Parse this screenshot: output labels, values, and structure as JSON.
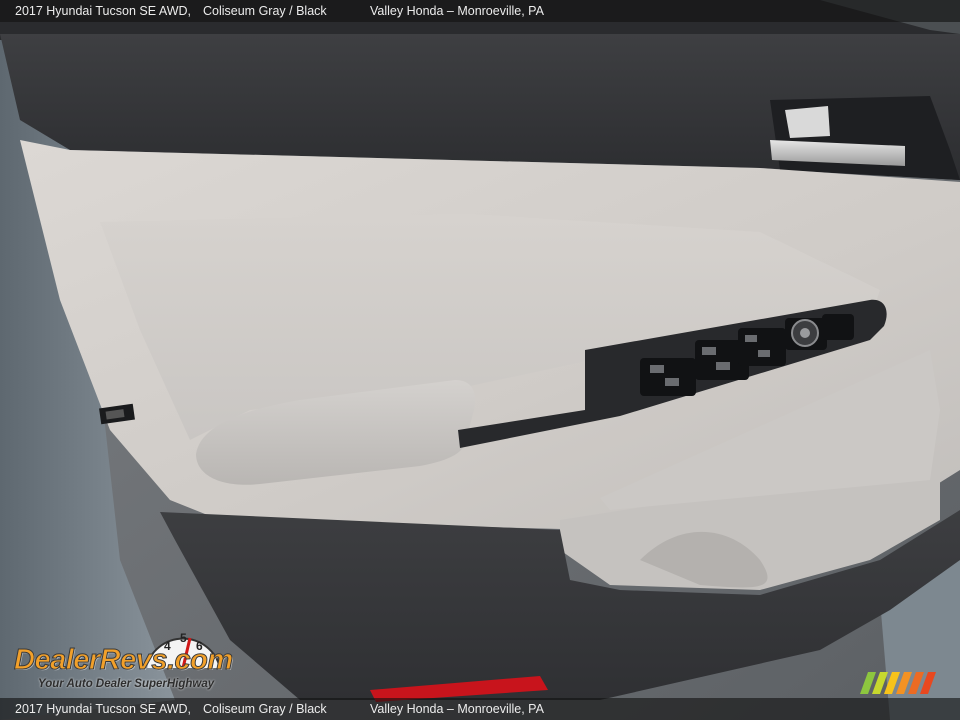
{
  "caption": {
    "vehicle": "2017 Hyundai Tucson SE AWD,",
    "color": "Coliseum Gray / Black",
    "dealer": "Valley Honda – Monroeville, PA"
  },
  "watermark": {
    "logo_text": "DealerRevs.com",
    "tagline": "Your Auto Dealer SuperHighway",
    "gauge_numbers": [
      "4",
      "5",
      "6"
    ]
  },
  "colors": {
    "interior_light": "#cfcbc7",
    "interior_dark": "#3a3b3e",
    "switch_panel": "#28292c",
    "logo_orange": "#f2a02a",
    "logo_blue": "#2f7fd0",
    "reflector_red": "#c8141c"
  }
}
